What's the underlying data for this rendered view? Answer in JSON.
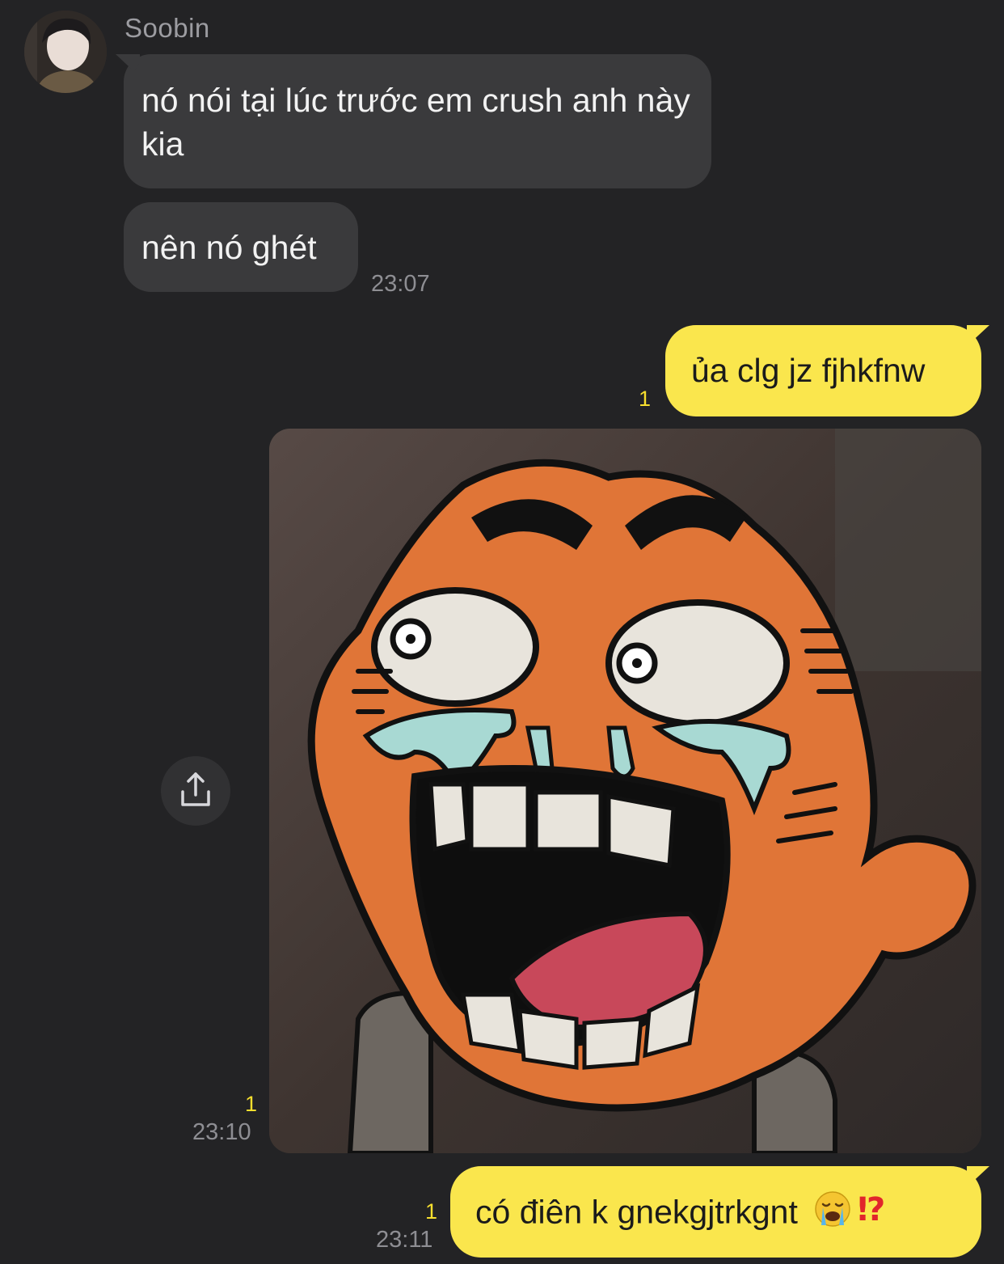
{
  "contact": {
    "name": "Soobin",
    "avatar_icon": "profile-photo"
  },
  "messages": {
    "in_1": "nó nói tại lúc trước em crush anh này kia",
    "in_2": "nên nó ghét",
    "in_time": "23:07",
    "out_1": "ủa clg jz fjhkfnw",
    "out_1_unread": "1",
    "photo_unread": "1",
    "photo_time": "23:10",
    "photo_icon": "crying-cartoon-photo",
    "out_2_text": "có điên k gnekgjtrkgnt",
    "out_2_emoji": "😭⁉️",
    "out_2_unread": "1",
    "out_2_time": "23:11"
  },
  "actions": {
    "share_icon": "share-icon"
  },
  "colors": {
    "background": "#232325",
    "incoming_bubble": "#3a3a3c",
    "outgoing_bubble": "#fae64d",
    "unread_count": "#f7df2e"
  }
}
